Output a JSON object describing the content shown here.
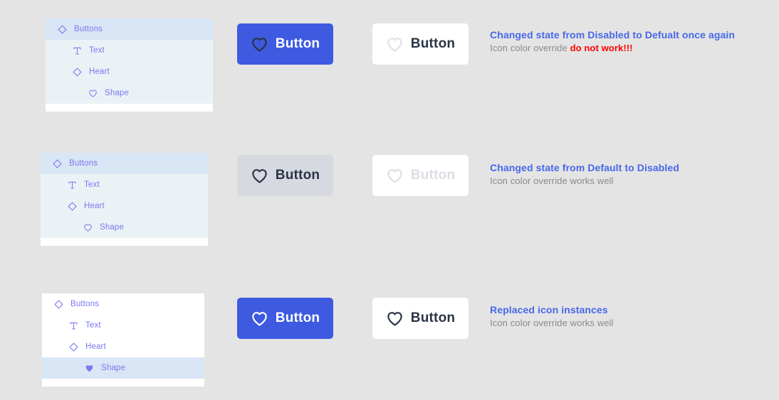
{
  "colors": {
    "page_background": "#e4e4e4",
    "accent_blue": "#3d5ae0",
    "note_blue": "#4668e8",
    "warning_red": "#ff0000",
    "layer_text": "#7b78f0",
    "layer_selected": "#d9e6f5",
    "layer_soft": "#ebf2f6",
    "disabled_fill": "#d6d9e0",
    "dark_text": "#2b3445",
    "muted_text": "#8a8a8a"
  },
  "layer_tree": {
    "items": [
      {
        "label": "Buttons",
        "icon": "component-diamond-icon",
        "depth": 0
      },
      {
        "label": "Text",
        "icon": "text-t-icon",
        "depth": 1
      },
      {
        "label": "Heart",
        "icon": "component-diamond-icon",
        "depth": 2
      },
      {
        "label": "Shape",
        "icon": "heart-icon",
        "depth": 3
      }
    ]
  },
  "rows": [
    {
      "id": "row-disabled-to-default",
      "panel": {
        "tints": [
          "selected",
          "soft",
          "soft",
          "soft"
        ],
        "shape_icon_filled": false
      },
      "primary_button": {
        "label": "Button",
        "icon": "heart-icon",
        "background": "#3d5ae0",
        "label_color": "#ffffff",
        "icon_color": "#2b3445",
        "state": "default"
      },
      "secondary_button": {
        "label": "Button",
        "icon": "heart-icon",
        "background": "#ffffff",
        "label_color": "#2b3445",
        "icon_color": "#e0e2e8",
        "state": "default"
      },
      "note": {
        "title": "Changed state from Disabled to Defualt once again",
        "subtitle_prefix": "Icon color override ",
        "subtitle_warning": "do not work!!!"
      }
    },
    {
      "id": "row-default-to-disabled",
      "panel": {
        "tints": [
          "selected",
          "soft",
          "soft",
          "soft"
        ],
        "shape_icon_filled": false
      },
      "primary_button": {
        "label": "Button",
        "icon": "heart-icon",
        "background": "#d6d9e0",
        "label_color": "#2b3445",
        "icon_color": "#2b3445",
        "state": "disabled"
      },
      "secondary_button": {
        "label": "Button",
        "icon": "heart-icon",
        "background": "#ffffff",
        "label_color": "#dcdee5",
        "icon_color": "#dcdee5",
        "state": "disabled"
      },
      "note": {
        "title": "Changed state from Default to Disabled",
        "subtitle_prefix": "Icon color override works well",
        "subtitle_warning": ""
      }
    },
    {
      "id": "row-replaced-instances",
      "panel": {
        "tints": [
          "white",
          "white",
          "white",
          "selected"
        ],
        "shape_icon_filled": true
      },
      "primary_button": {
        "label": "Button",
        "icon": "heart-icon",
        "background": "#3d5ae0",
        "label_color": "#ffffff",
        "icon_color": "#ffffff",
        "state": "default"
      },
      "secondary_button": {
        "label": "Button",
        "icon": "heart-icon",
        "background": "#ffffff",
        "label_color": "#2b3445",
        "icon_color": "#2b3445",
        "state": "default"
      },
      "note": {
        "title": "Replaced icon instances",
        "subtitle_prefix": "Icon color override works well",
        "subtitle_warning": ""
      }
    }
  ]
}
